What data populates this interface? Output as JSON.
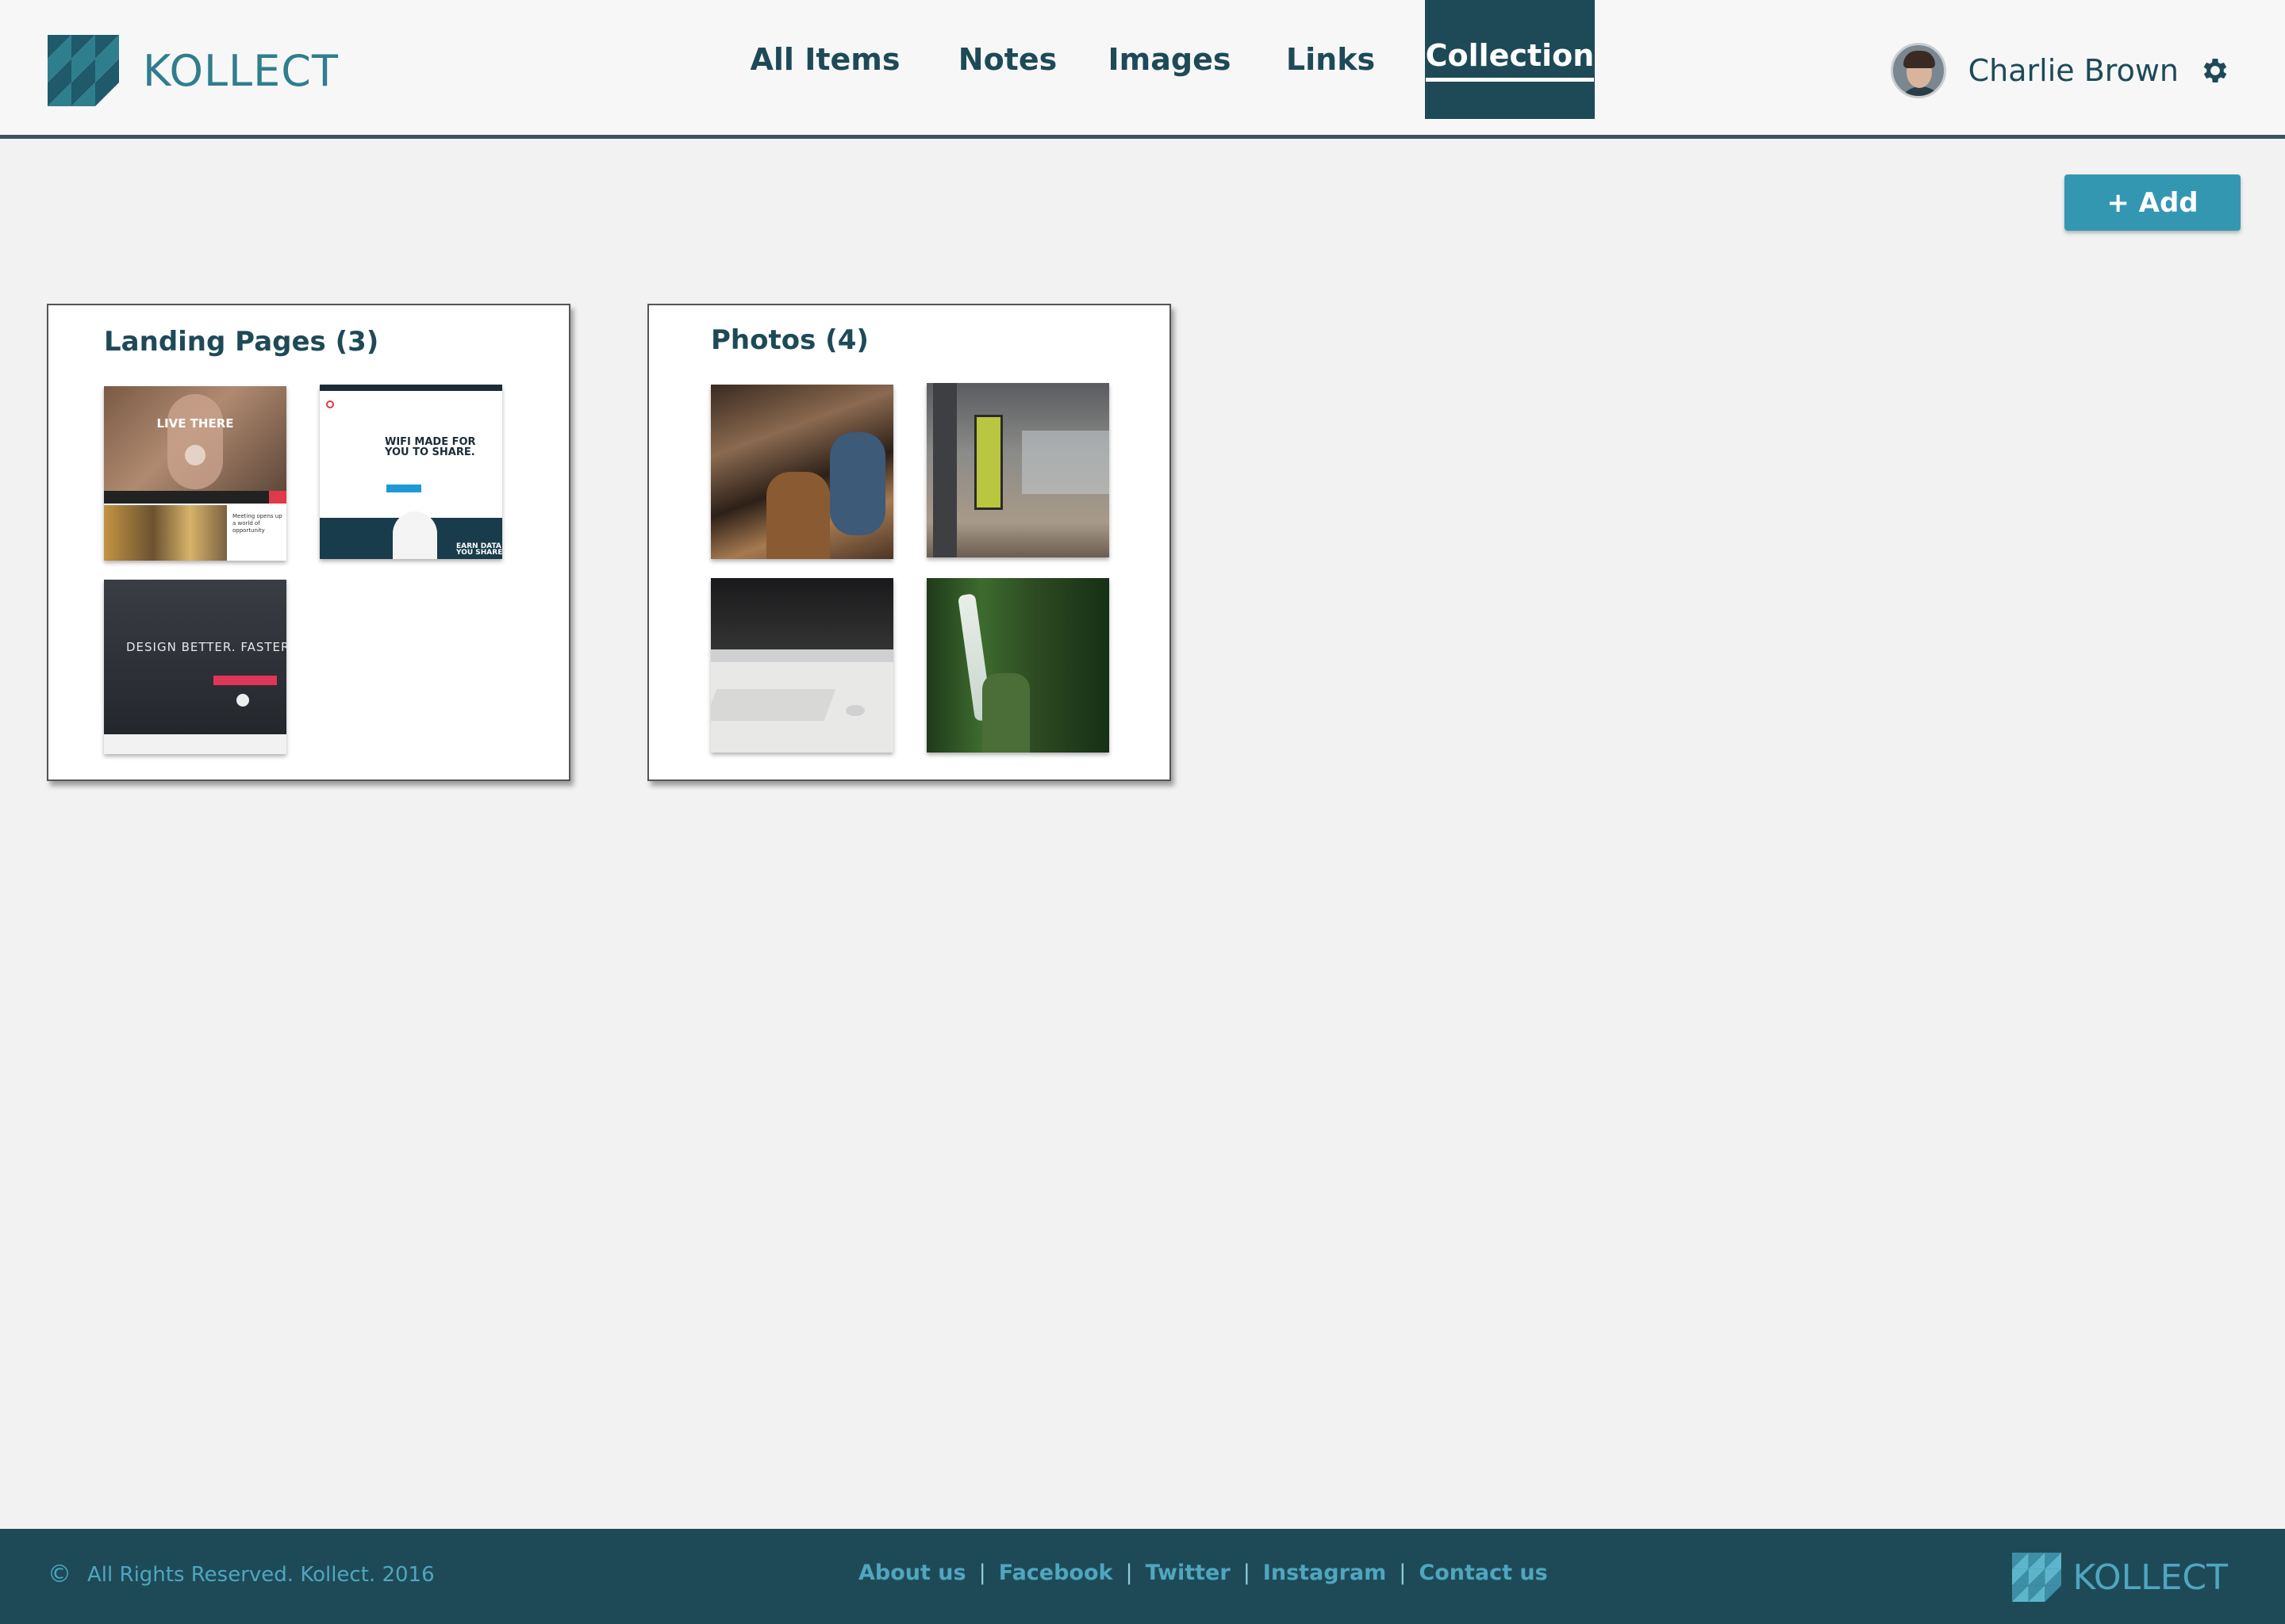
{
  "brand": {
    "name": "KOLLECT"
  },
  "nav": {
    "items": [
      {
        "label": "All Items"
      },
      {
        "label": "Notes"
      },
      {
        "label": "Images"
      },
      {
        "label": "Links"
      },
      {
        "label": "Collection",
        "active": true
      }
    ]
  },
  "user": {
    "name": "Charlie Brown"
  },
  "toolbar": {
    "add_label": "+ Add"
  },
  "collections": [
    {
      "title": "Landing Pages (3)",
      "thumbs": [
        {
          "kind": "landing",
          "headline": "LIVE THERE",
          "subline": "Meeting opens up a world of opportunity"
        },
        {
          "kind": "landing",
          "headline": "WIFI MADE FOR YOU TO SHARE.",
          "subline": "EARN DATA YOU SHARE"
        },
        {
          "kind": "landing",
          "headline": "DESIGN BETTER. FASTER."
        }
      ]
    },
    {
      "title": "Photos (4)",
      "thumbs": [
        {
          "kind": "photo",
          "subject": "cafe"
        },
        {
          "kind": "photo",
          "subject": "office"
        },
        {
          "kind": "photo",
          "subject": "desk-computer"
        },
        {
          "kind": "photo",
          "subject": "waterfall"
        }
      ]
    }
  ],
  "footer": {
    "copyright": "All Rights Reserved.  Kollect. 2016",
    "links": [
      "About us",
      "Facebook",
      "Twitter",
      "Instagram",
      "Contact us"
    ],
    "brand": "KOLLECT"
  },
  "colors": {
    "primary": "#1e4a58",
    "accent": "#3497b2",
    "link": "#4fa6bf"
  }
}
